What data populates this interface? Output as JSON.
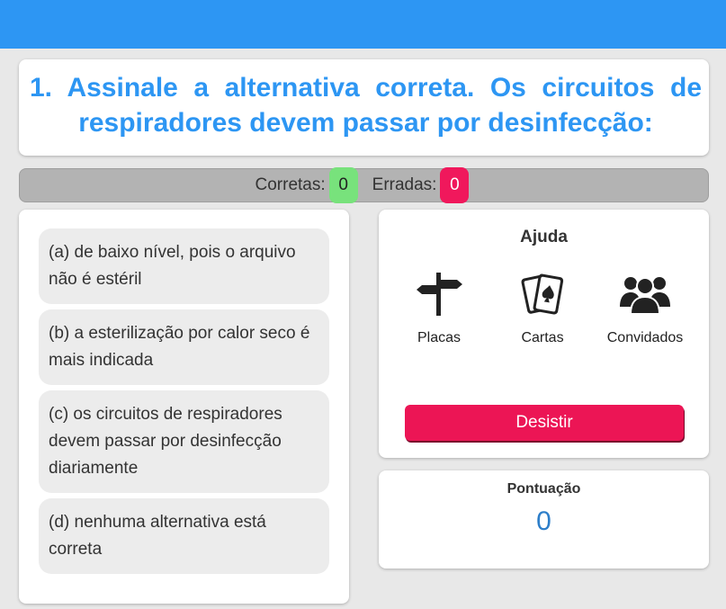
{
  "question": {
    "text": "1. Assinale a alternativa correta. Os circuitos de respiradores devem passar por desinfecção:"
  },
  "score": {
    "correct_label": "Corretas:",
    "correct_value": "0",
    "wrong_label": "Erradas:",
    "wrong_value": "0"
  },
  "options": [
    {
      "label": "(a) de baixo nível, pois o arquivo não é estéril"
    },
    {
      "label": "(b) a esterilização por calor seco é mais indicada"
    },
    {
      "label": "(c) os circuitos de respiradores devem passar por desinfecção diariamente"
    },
    {
      "label": "(d) nenhuma alternativa está correta"
    }
  ],
  "help": {
    "title": "Ajuda",
    "items": [
      {
        "label": "Placas",
        "icon": "signpost-icon"
      },
      {
        "label": "Cartas",
        "icon": "playing-cards-icon"
      },
      {
        "label": "Convidados",
        "icon": "users-icon"
      }
    ],
    "quit_label": "Desistir"
  },
  "points": {
    "title": "Pontuação",
    "value": "0"
  },
  "colors": {
    "header": "#2d96f3",
    "question_text": "#2d96f3",
    "correct_badge": "#78e27c",
    "wrong_badge": "#f0185c",
    "quit_button": "#ec1555",
    "points_value": "#2d7ec9"
  }
}
